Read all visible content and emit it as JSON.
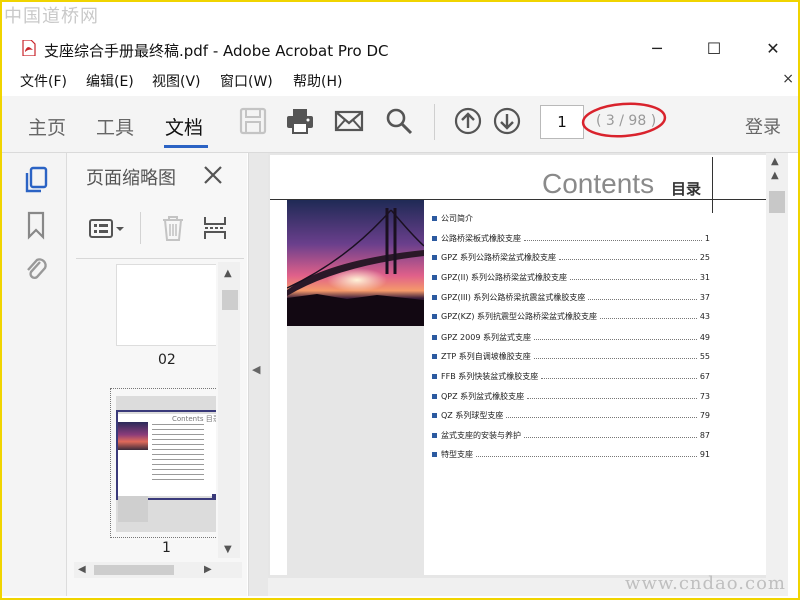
{
  "watermark": {
    "top": "中国道桥网",
    "bottom": "www.cndao.com"
  },
  "window": {
    "title": "支座综合手册最终稿.pdf - Adobe Acrobat Pro DC",
    "minimize": "─",
    "maximize": "☐",
    "close": "✕"
  },
  "menu": {
    "items": [
      "文件(F)",
      "编辑(E)",
      "视图(V)",
      "窗口(W)",
      "帮助(H)"
    ],
    "close": "×"
  },
  "toolbar": {
    "tabs": [
      "主页",
      "工具",
      "文档"
    ],
    "active_tab": "文档",
    "page_number": "1",
    "page_count": "( 3 / 98 )",
    "login": "登录",
    "icons": [
      "save-icon",
      "print-icon",
      "mail-icon",
      "search-icon",
      "page-up-icon",
      "page-down-icon"
    ]
  },
  "thumbnail_panel": {
    "title": "页面缩略图",
    "pages": [
      {
        "label": "02"
      },
      {
        "label": "1",
        "thumb_heading": "Contents 目录"
      }
    ]
  },
  "document": {
    "heading_en": "Contents",
    "heading_cn": "目录",
    "toc": [
      {
        "title": "公司简介",
        "page": ""
      },
      {
        "title": "公路桥梁板式橡胶支座",
        "page": "1"
      },
      {
        "title": "GPZ 系列公路桥梁盆式橡胶支座",
        "page": "25"
      },
      {
        "title": "GPZ(II) 系列公路桥梁盆式橡胶支座",
        "page": "31"
      },
      {
        "title": "GPZ(III) 系列公路桥梁抗震盆式橡胶支座",
        "page": "37"
      },
      {
        "title": "GPZ(KZ) 系列抗震型公路桥梁盆式橡胶支座",
        "page": "43"
      },
      {
        "title": "GPZ 2009 系列盆式支座",
        "page": "49"
      },
      {
        "title": "ZTP 系列自调坡橡胶支座",
        "page": "55"
      },
      {
        "title": "FFB 系列快装盆式橡胶支座",
        "page": "67"
      },
      {
        "title": "QPZ 系列盆式橡胶支座",
        "page": "73"
      },
      {
        "title": "QZ 系列球型支座",
        "page": "79"
      },
      {
        "title": "盆式支座的安装与养护",
        "page": "87"
      },
      {
        "title": "特型支座",
        "page": "91"
      }
    ]
  },
  "colors": {
    "accent": "#2b63c4",
    "annotation": "#d9232d",
    "frame": "#f0d400"
  }
}
